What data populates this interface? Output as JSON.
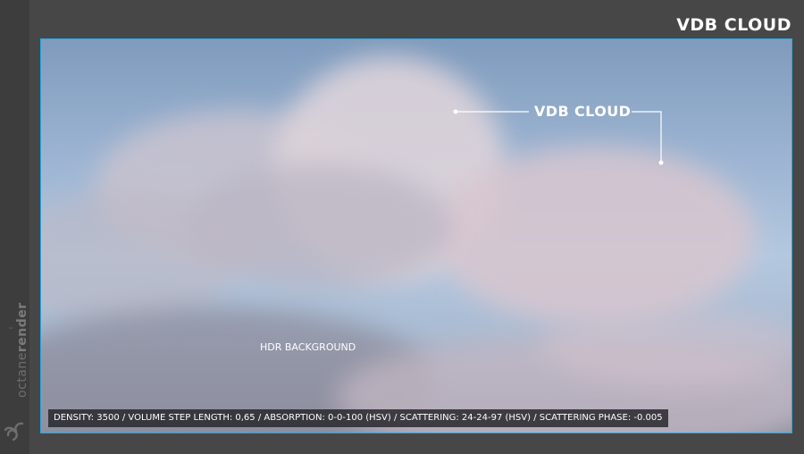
{
  "header": {
    "title": "VDB CLOUD"
  },
  "brand": {
    "name_light": "octane",
    "name_bold": "render",
    "trademark": "™",
    "icon": "octane-logo-icon"
  },
  "render": {
    "annotation_label": "VDB CLOUD",
    "background_label": "HDR BACKGROUND",
    "parameters": "DENSITY: 3500 / VOLUME STEP LENGTH: 0,65 / ABSORPTION: 0-0-100 (HSV) / SCATTERING: 24-24-97 (HSV) / SCATTERING PHASE: -0.005"
  },
  "colors": {
    "frame_border": "#2aa7e0",
    "page_background": "#474747",
    "label_text": "#ffffff"
  }
}
